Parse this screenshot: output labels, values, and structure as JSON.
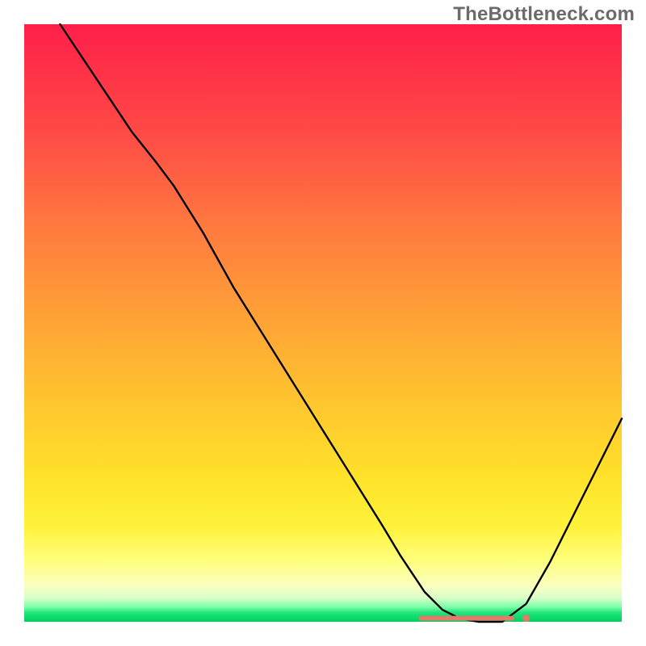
{
  "watermark": "TheBottleneck.com",
  "colors": {
    "curve": "#000000",
    "dot": "#e47a6a",
    "gradient_top": "#ff1f4a",
    "gradient_mid": "#ffc72e",
    "gradient_low": "#fff23a",
    "gradient_bottom": "#00d060"
  },
  "chart_data": {
    "type": "line",
    "title": "",
    "xlabel": "",
    "ylabel": "",
    "xlim": [
      0,
      100
    ],
    "ylim": [
      0,
      100
    ],
    "grid": false,
    "legend": false,
    "series": [
      {
        "name": "bottleneck-curve",
        "x": [
          6,
          10,
          14,
          18,
          22,
          25,
          30,
          35,
          40,
          45,
          50,
          55,
          60,
          63,
          65,
          67,
          70,
          73,
          76,
          80,
          84,
          88,
          92,
          96,
          100
        ],
        "y": [
          100,
          94,
          88,
          82,
          77,
          73,
          65,
          56,
          48,
          40,
          32,
          24,
          16,
          11,
          8,
          5,
          2,
          0.5,
          0,
          0,
          3,
          10,
          18,
          26,
          34
        ]
      }
    ],
    "markers": {
      "name": "optimal-band",
      "x_start": 66,
      "x_end": 82,
      "y": 0.6,
      "outlier_x": 84,
      "outlier_y": 0.6
    }
  }
}
